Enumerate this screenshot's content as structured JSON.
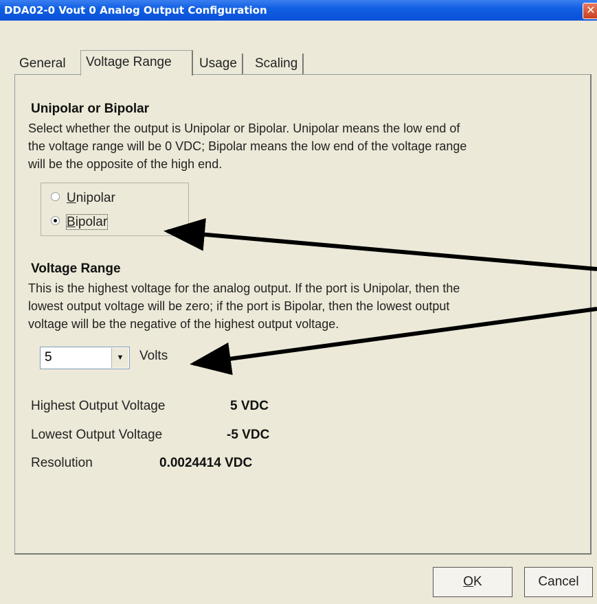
{
  "window": {
    "title": "DDA02-0 Vout 0 Analog Output Configuration",
    "close_glyph": "✕"
  },
  "tabs": [
    {
      "label": "General"
    },
    {
      "label": "Voltage Range",
      "active": true
    },
    {
      "label": "Usage"
    },
    {
      "label": "Scaling"
    }
  ],
  "polarity": {
    "heading": "Unipolar or Bipolar",
    "description": [
      "Select whether the output is Unipolar or Bipolar.  Unipolar means the low end of",
      "the voltage range will be 0 VDC; Bipolar means the low end of the voltage range",
      "will be the opposite of the high end."
    ],
    "options": [
      {
        "label": "Unipolar",
        "accel": "U",
        "rest": "nipolar",
        "selected": false
      },
      {
        "label": "Bipolar",
        "accel": "B",
        "rest": "ipolar",
        "selected": true
      }
    ]
  },
  "voltage_range": {
    "heading": "Voltage Range",
    "description": [
      "This is the highest voltage for the analog output.  If the port is Unipolar, then the",
      "lowest output voltage will be zero; if the port is Bipolar, then the lowest output",
      "voltage will be the negative of the highest output voltage."
    ],
    "selected_value": "5",
    "units": "Volts"
  },
  "summary": [
    {
      "label": "Highest Output Voltage",
      "value": "5 VDC"
    },
    {
      "label": "Lowest Output Voltage",
      "value": "-5 VDC"
    },
    {
      "label": "Resolution",
      "value": "0.0024414 VDC"
    }
  ],
  "buttons": {
    "ok": "OK",
    "ok_accel": "O",
    "ok_rest": "K",
    "cancel": "Cancel"
  },
  "colors": {
    "titlebar": "#0a50d8",
    "dialog_bg": "#ece9d8",
    "annotation_arrow": "#000000"
  }
}
